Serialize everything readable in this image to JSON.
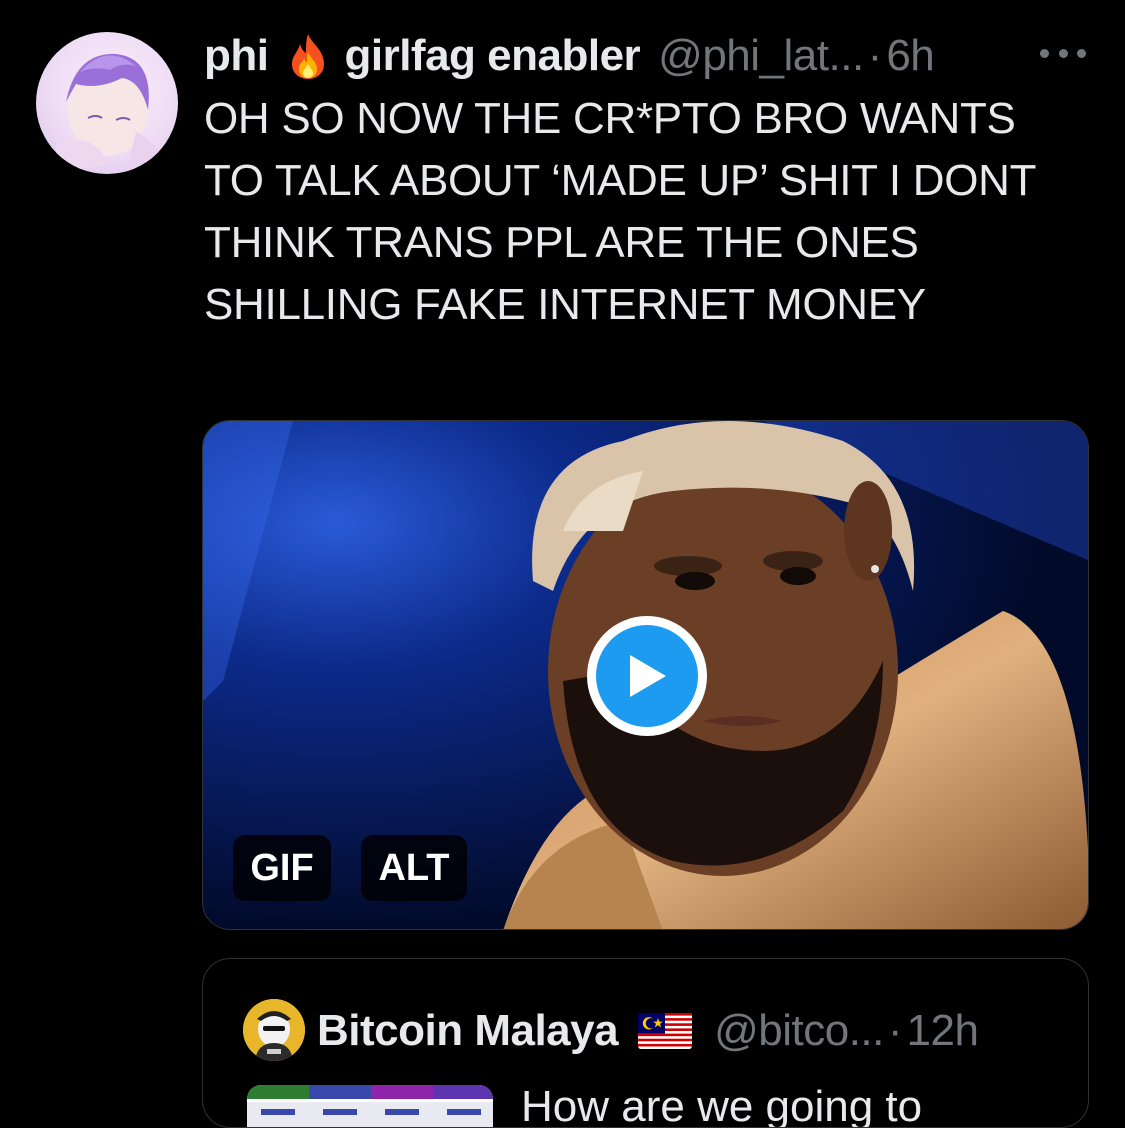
{
  "tweet": {
    "display_name": "phi",
    "display_name_suffix": "girlfag enabler",
    "emoji_icon": "fire-emoji",
    "handle": "@phi_lat...",
    "separator": "·",
    "time": "6h",
    "more_icon": "more-horizontal-icon",
    "text": "OH SO NOW THE CR*PTO BRO WANTS TO TALK ABOUT ‘MADE UP’ SHIT I DONT THINK TRANS PPL ARE THE ONES SHILLING FAKE INTERNET MONEY"
  },
  "media": {
    "type_badge": "GIF",
    "alt_badge": "ALT",
    "play_icon": "play-icon",
    "colors": {
      "play_button": "#1d9bf0",
      "background": "#06133d"
    }
  },
  "quote": {
    "display_name": "Bitcoin Malaya",
    "flag_icon": "malaysia-flag-emoji",
    "handle": "@bitco...",
    "separator": "·",
    "time": "12h",
    "text": "How are we going to"
  },
  "colors": {
    "background": "#000000",
    "primary_text": "#e7e9ea",
    "secondary_text": "#71767b",
    "border": "#2f3336"
  }
}
